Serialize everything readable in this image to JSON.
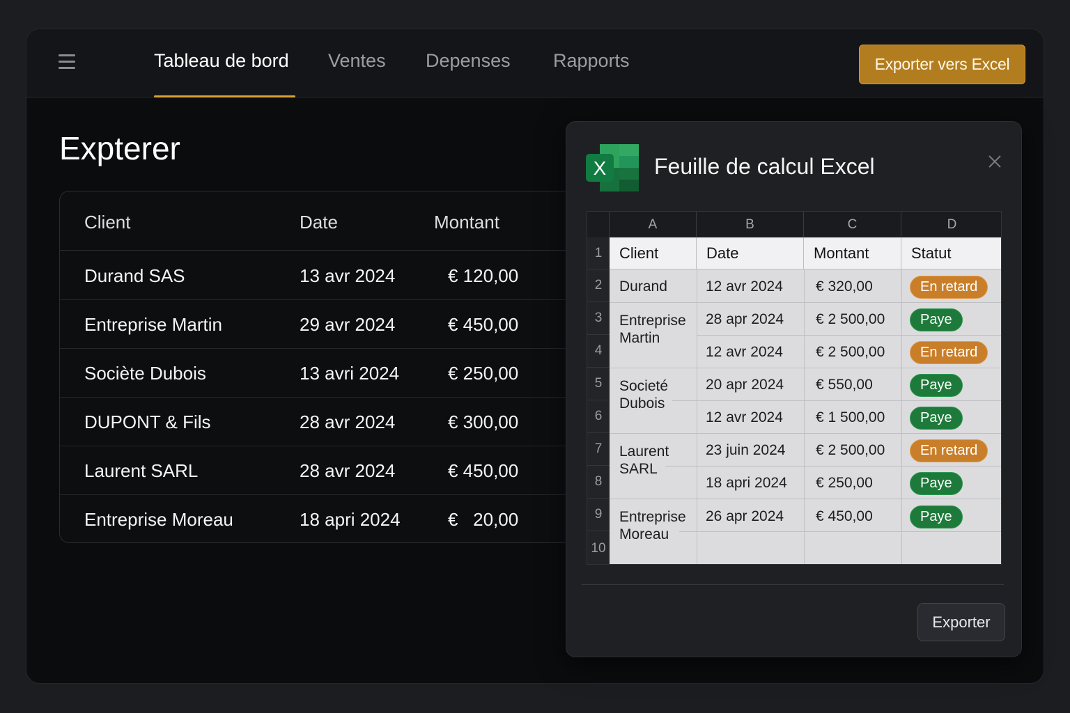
{
  "nav": {
    "tabs": [
      {
        "label": "Tableau de bord",
        "active": true
      },
      {
        "label": "Ventes",
        "active": false
      },
      {
        "label": "Depenses",
        "active": false
      },
      {
        "label": "Rapports",
        "active": false
      }
    ],
    "export_label": "Exporter vers Excel",
    "accent_color": "#d9a23a"
  },
  "main": {
    "title": "Expterer",
    "table": {
      "headers": [
        "Client",
        "Date",
        "Montant"
      ],
      "rows": [
        {
          "client": "Durand SAS",
          "date": "13 avr 2024",
          "amount": "€ 120,00"
        },
        {
          "client": "Entreprise Martin",
          "date": "29 avr 2024",
          "amount": "€ 450,00"
        },
        {
          "client": "Sociète Dubois",
          "date": "13 avri 2024",
          "amount": "€ 250,00"
        },
        {
          "client": "DUPONT & Fils",
          "date": "28 avr 2024",
          "amount": "€ 300,00"
        },
        {
          "client": "Laurent SARL",
          "date": "28 avr 2024",
          "amount": "€ 450,00"
        },
        {
          "client": "Entreprise Moreau",
          "date": "18 apri 2024",
          "amount": "€   20,00"
        }
      ]
    }
  },
  "dialog": {
    "title": "Feuille de calcul Excel",
    "logo_letter": "X",
    "sheet": {
      "columns": [
        "A",
        "B",
        "C",
        "D"
      ],
      "row_numbers": [
        "1",
        "2",
        "3",
        "4",
        "5",
        "6",
        "7",
        "8",
        "9",
        "10"
      ],
      "headers": [
        "Client",
        "Date",
        "Montant",
        "Statut"
      ],
      "clients": [
        {
          "name": "Durand"
        },
        {
          "name": "Entreprise\nMartin"
        },
        {
          "name": "Societé\nDubois"
        },
        {
          "name": "Laurent\nSARL"
        },
        {
          "name": "Entreprise\nMoreau"
        }
      ],
      "rows": [
        {
          "date": "12 avr 2024",
          "amount": "€ 320,00",
          "status": "En retard",
          "status_type": "late"
        },
        {
          "date": "28 apr 2024",
          "amount": "€ 2 500,00",
          "status": "Paye",
          "status_type": "paid"
        },
        {
          "date": "12 avr 2024",
          "amount": "€ 2 500,00",
          "status": "En retard",
          "status_type": "late"
        },
        {
          "date": "20 apr 2024",
          "amount": "€ 550,00",
          "status": "Paye",
          "status_type": "paid"
        },
        {
          "date": "12 avr 2024",
          "amount": "€ 1 500,00",
          "status": "Paye",
          "status_type": "paid"
        },
        {
          "date": "23 juin 2024",
          "amount": "€ 2 500,00",
          "status": "En retard",
          "status_type": "late"
        },
        {
          "date": "18 apri 2024",
          "amount": "€ 250,00",
          "status": "Paye",
          "status_type": "paid"
        },
        {
          "date": "26 apr 2024",
          "amount": "€ 450,00",
          "status": "Paye",
          "status_type": "paid"
        }
      ],
      "status_colors": {
        "late": "#c97e2a",
        "paid": "#1e7a3a"
      }
    },
    "export_label": "Exporter"
  }
}
